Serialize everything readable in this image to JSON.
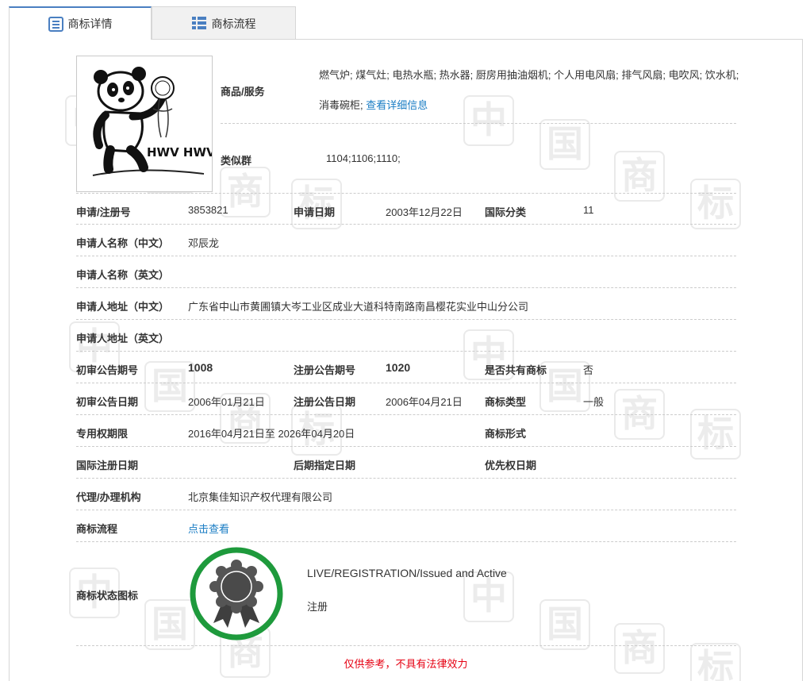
{
  "tabs": [
    {
      "label": "商标详情",
      "active": true
    },
    {
      "label": "商标流程",
      "active": false
    }
  ],
  "logo": {
    "text": "HWV HWV"
  },
  "watermark_chars": [
    "中",
    "国",
    "商",
    "标"
  ],
  "goods": {
    "label": "商品/服务",
    "value": "燃气炉; 煤气灶; 电热水瓶; 热水器; 厨房用抽油烟机; 个人用电风扇; 排气风扇; 电吹风; 饮水机; 消毒碗柜;",
    "link": "查看详细信息"
  },
  "similar_group": {
    "label": "类似群",
    "value": "1104;1106;1110;"
  },
  "reg_no": {
    "label": "申请/注册号",
    "value": "3853821"
  },
  "apply_date": {
    "label": "申请日期",
    "value": "2003年12月22日"
  },
  "intl_class": {
    "label": "国际分类",
    "value": "11"
  },
  "applicant_cn": {
    "label": "申请人名称（中文）",
    "value": "邓辰龙"
  },
  "applicant_en": {
    "label": "申请人名称（英文）",
    "value": ""
  },
  "address_cn": {
    "label": "申请人地址（中文）",
    "value": "广东省中山市黄圃镇大岑工业区成业大道科特南路南昌樱花实业中山分公司"
  },
  "address_en": {
    "label": "申请人地址（英文）",
    "value": ""
  },
  "prelim_no": {
    "label": "初审公告期号",
    "value": "1008"
  },
  "reg_announce_no": {
    "label": "注册公告期号",
    "value": "1020"
  },
  "shared": {
    "label": "是否共有商标",
    "value": "否"
  },
  "prelim_date": {
    "label": "初审公告日期",
    "value": "2006年01月21日"
  },
  "reg_announce_date": {
    "label": "注册公告日期",
    "value": "2006年04月21日"
  },
  "mark_type": {
    "label": "商标类型",
    "value": "一般"
  },
  "exclusive_period": {
    "label": "专用权期限",
    "value": "2016年04月21日至 2026年04月20日"
  },
  "mark_form": {
    "label": "商标形式",
    "value": ""
  },
  "intl_reg_date": {
    "label": "国际注册日期",
    "value": ""
  },
  "later_designation": {
    "label": "后期指定日期",
    "value": ""
  },
  "priority_date": {
    "label": "优先权日期",
    "value": ""
  },
  "agent": {
    "label": "代理/办理机构",
    "value": "北京集佳知识产权代理有限公司"
  },
  "process": {
    "label": "商标流程",
    "link": "点击查看"
  },
  "status": {
    "label": "商标状态图标",
    "line1": "LIVE/REGISTRATION/Issued and Active",
    "line2": "注册",
    "ring_color": "#1e9a3c"
  },
  "disclaimer": "仅供参考，不具有法律效力",
  "colors": {
    "accent": "#4a7fc1",
    "link": "#1a7dc4",
    "prev_arrow": "#f39325",
    "next_arrow": "#5b9bd5",
    "disclaimer": "#e60012"
  }
}
